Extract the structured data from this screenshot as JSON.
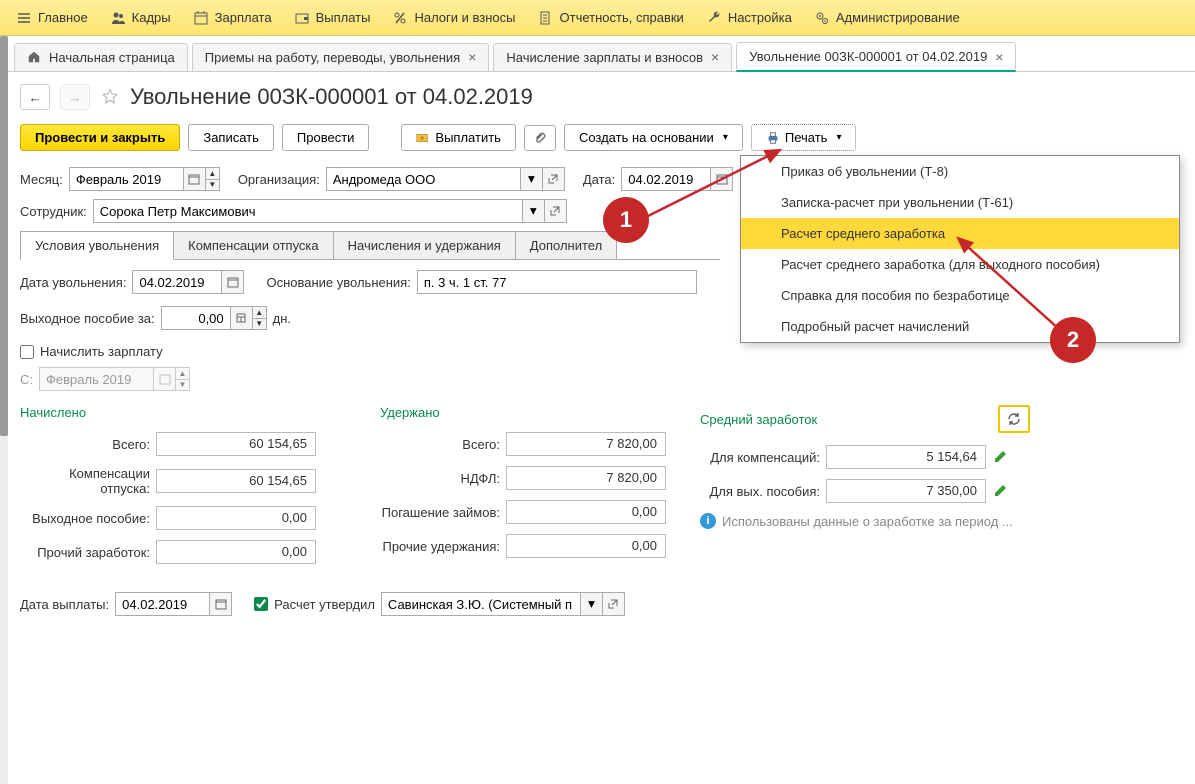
{
  "menu": {
    "main": "Главное",
    "kadry": "Кадры",
    "zarplata": "Зарплата",
    "vyplaty": "Выплаты",
    "nalogi": "Налоги и взносы",
    "otchetnost": "Отчетность, справки",
    "nastroika": "Настройка",
    "admin": "Администрирование"
  },
  "tabs": {
    "t0": "Начальная страница",
    "t1": "Приемы на работу, переводы, увольнения",
    "t2": "Начисление зарплаты и взносов",
    "t3": "Увольнение 00ЗК-000001 от 04.02.2019"
  },
  "title": "Увольнение 00ЗК-000001 от 04.02.2019",
  "toolbar": {
    "provesti_zakryt": "Провести и закрыть",
    "zapisat": "Записать",
    "provesti": "Провести",
    "vyplatit": "Выплатить",
    "sozdat_na": "Создать на основании",
    "pechat": "Печать"
  },
  "fields": {
    "month_label": "Месяц:",
    "month_value": "Февраль 2019",
    "org_label": "Организация:",
    "org_value": "Андромеда ООО",
    "date_label": "Дата:",
    "date_value": "04.02.2019",
    "employee_label": "Сотрудник:",
    "employee_value": "Сорока Петр Максимович"
  },
  "subtabs": {
    "st1": "Условия увольнения",
    "st2": "Компенсации отпуска",
    "st3": "Начисления и удержания",
    "st4": "Дополнител"
  },
  "dismiss": {
    "date_label": "Дата увольнения:",
    "date_value": "04.02.2019",
    "basis_label": "Основание увольнения:",
    "basis_value": "п. 3 ч. 1 ст. 77",
    "severance_label": "Выходное пособие за:",
    "severance_value": "0,00",
    "severance_unit": "дн.",
    "accrue_salary": "Начислить зарплату",
    "s_label": "С:",
    "s_value": "Февраль 2019"
  },
  "summary": {
    "col1": {
      "head": "Начислено",
      "total_lbl": "Всего:",
      "total": "60 154,65",
      "komp_lbl": "Компенсации отпуска:",
      "komp": "60 154,65",
      "vyh_lbl": "Выходное пособие:",
      "vyh": "0,00",
      "proch_lbl": "Прочий заработок:",
      "proch": "0,00"
    },
    "col2": {
      "head": "Удержано",
      "total_lbl": "Всего:",
      "total": "7 820,00",
      "ndfl_lbl": "НДФЛ:",
      "ndfl": "7 820,00",
      "pog_lbl": "Погашение займов:",
      "pog": "0,00",
      "proch_lbl": "Прочие удержания:",
      "proch": "0,00"
    },
    "col3": {
      "head": "Средний заработок",
      "komp_lbl": "Для компенсаций:",
      "komp": "5 154,64",
      "vyh_lbl": "Для вых. пособия:",
      "vyh": "7 350,00",
      "note": "Использованы данные о заработке за период ..."
    }
  },
  "footer": {
    "paydate_label": "Дата выплаты:",
    "paydate_value": "04.02.2019",
    "approved_label": "Расчет утвердил",
    "approved_value": "Савинская З.Ю. (Системный п"
  },
  "print_menu": {
    "i1": "Приказ об увольнении (Т-8)",
    "i2": "Записка-расчет при увольнении (Т-61)",
    "i3": "Расчет среднего заработка",
    "i4": "Расчет среднего заработка (для выходного пособия)",
    "i5": "Справка для пособия по безработице",
    "i6": "Подробный расчет начислений"
  },
  "annotations": {
    "a1": "1",
    "a2": "2"
  }
}
